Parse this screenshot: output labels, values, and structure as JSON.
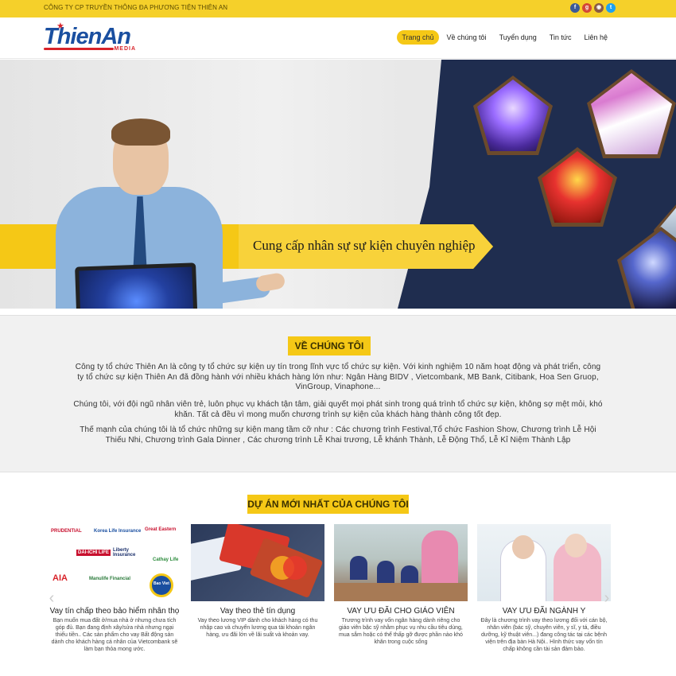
{
  "topbar": {
    "company": "CÔNG TY CP TRUYỀN THÔNG ĐA PHƯƠNG TIỆN THIÊN AN",
    "socials": [
      {
        "icon": "facebook-icon",
        "glyph": "f",
        "color": "#3b5998"
      },
      {
        "icon": "google-plus-icon",
        "glyph": "g",
        "color": "#d34836"
      },
      {
        "icon": "instagram-icon",
        "glyph": "◉",
        "color": "#8a5a44"
      },
      {
        "icon": "twitter-icon",
        "glyph": "t",
        "color": "#1da1f2"
      }
    ]
  },
  "header": {
    "logo_brand": "ThienAn",
    "logo_sub": "MEDIA",
    "nav": [
      {
        "label": "Trang chủ",
        "active": true
      },
      {
        "label": "Về chúng tôi",
        "active": false
      },
      {
        "label": "Tuyển dụng",
        "active": false
      },
      {
        "label": "Tin tức",
        "active": false
      },
      {
        "label": "Liên hệ",
        "active": false
      }
    ]
  },
  "hero": {
    "tagline": "Cung cấp nhân sự sự kiện chuyên nghiệp"
  },
  "about": {
    "title": "VỀ CHÚNG TÔI",
    "paragraphs": [
      "Công ty tổ chức Thiên An là công ty tổ chức sự kiện uy tín trong lĩnh vực tổ chức sự kiện. Với kinh nghiệm 10 năm hoạt động và phát triển, công ty tổ chức sự kiện Thiên An đã đồng hành với nhiều khách hàng lớn như: Ngân Hàng BIDV , Vietcombank, MB Bank, Citibank, Hoa Sen Gruop, VinGroup, Vinaphone...",
      "Chúng tôi, với đội ngũ nhân viên trẻ, luôn phục vụ khách tận tâm, giải quyết mọi phát sinh trong quá trình tổ chức sự kiện, không sợ mệt mỏi, khó khăn. Tất cả đều vì mong muốn chương trình sự kiện của khách hàng thành công tốt đẹp.",
      "Thế mạnh của chúng tôi là tổ chức những sự kiện mang tầm cỡ như : Các chương trình Festival,Tổ chức Fashion Show, Chương trình Lễ Hội Thiếu Nhi, Chương trình Gala Dinner , Các chương trình Lễ Khai trương, Lễ khánh Thành, Lễ Động Thổ, Lễ Kỉ Niệm Thành Lập"
    ]
  },
  "projects": {
    "title": "DỰ ÁN MỚI NHẤT CỦA CHÚNG TÔI",
    "cards": [
      {
        "title": "Vay tín chấp theo bảo hiểm nhân thọ",
        "desc": "Bạn muốn mua đất ở/mua nhà ở nhưng chưa tích góp đủ. Bạn đang định xây/sửa nhà nhưng ngại thiếu tiền.. Các sản phẩm cho vay Bất động sản dành cho khách hàng cá nhân của Vietcombank sẽ làm bạn thỏa mong ước."
      },
      {
        "title": "Vay theo thẻ tín dụng",
        "desc": "Vay theo lương VIP dành cho khách hàng có thu nhập cao và chuyển lương qua tài khoản ngân hàng, ưu đãi lớn về lãi suất và khoản vay."
      },
      {
        "title": "VAY ƯU ĐÃI CHO GIÁO VIÊN",
        "desc": "Trương trình vay vốn ngân hàng dành riêng cho giáo viên bậc sỹ nhằm phục vụ nhu cầu tiêu dùng, mua sắm hoặc có thể thấp gỡ được phần nào khó khăn trong cuộc sống"
      },
      {
        "title": "VAY ƯU ĐÃI NGÀNH Y",
        "desc": "Đây là chương trình vay theo lương đối với cán bộ, nhân viên (bác sỹ, chuyên viên, y sĩ, y tá, điều dưỡng, kỹ thuật viên...) đang công tác tại các bệnh viện trên địa bàn Hà Nội.. Hình thức vay vốn tín chấp không cần tài sản đảm bảo."
      }
    ],
    "insurer_logos": [
      "PRUDENTIAL",
      "Korea Life Insurance",
      "Great Eastern",
      "DAI-ICHI LIFE",
      "Liberty Insurance",
      "Cathay Life",
      "AIA",
      "Manulife Financial",
      "Bao Viet"
    ]
  },
  "colors": {
    "accent": "#f5c816",
    "navy": "#1f2d4f",
    "brand_blue": "#1a4fa0",
    "brand_red": "#d8232a"
  }
}
